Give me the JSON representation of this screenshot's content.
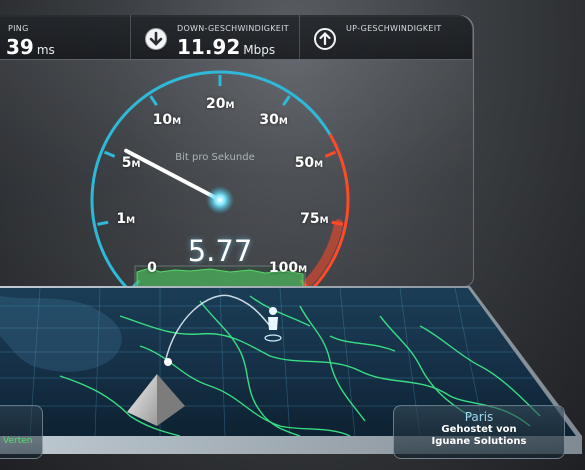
{
  "stats": {
    "ping": {
      "label": "PING",
      "value": "39",
      "unit": "ms"
    },
    "download": {
      "label": "DOWN-GESCHWINDIGKEIT",
      "value": "11.92",
      "unit": "Mbps",
      "icon": "download-arrow-icon"
    },
    "upload": {
      "label": "UP-GESCHWINDIGKEIT",
      "value": "",
      "unit": "",
      "icon": "upload-arrow-icon"
    }
  },
  "gauge": {
    "unit_label": "Bit pro Sekunde",
    "current_value": "5.77",
    "needle_value_mbps": 5.77,
    "ticks": [
      {
        "num": "0",
        "unit": ""
      },
      {
        "num": "1",
        "unit": "M"
      },
      {
        "num": "5",
        "unit": "M"
      },
      {
        "num": "10",
        "unit": "M"
      },
      {
        "num": "20",
        "unit": "M"
      },
      {
        "num": "30",
        "unit": "M"
      },
      {
        "num": "50",
        "unit": "M"
      },
      {
        "num": "75",
        "unit": "M"
      },
      {
        "num": "100",
        "unit": "M"
      }
    ],
    "colors": {
      "low_arc": "#2fb8d8",
      "high_arc": "#ff4a2a",
      "graph": "#58d86a"
    }
  },
  "map": {
    "server": {
      "city": "Paris",
      "host_line1": "Gehostet von",
      "host_line2": "Iguane Solutions"
    },
    "left_card_text": "Verten"
  }
}
